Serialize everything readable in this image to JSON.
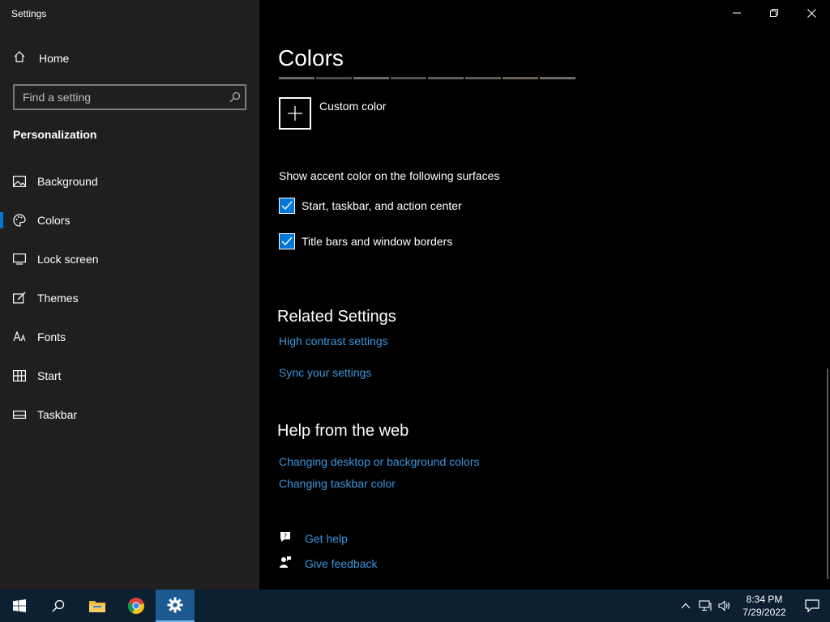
{
  "window": {
    "title": "Settings"
  },
  "sidebar": {
    "home_label": "Home",
    "search_placeholder": "Find a setting",
    "section_title": "Personalization",
    "items": [
      {
        "label": "Background",
        "icon": "picture-icon"
      },
      {
        "label": "Colors",
        "icon": "palette-icon",
        "active": true
      },
      {
        "label": "Lock screen",
        "icon": "lock-screen-icon"
      },
      {
        "label": "Themes",
        "icon": "themes-icon"
      },
      {
        "label": "Fonts",
        "icon": "fonts-icon"
      },
      {
        "label": "Start",
        "icon": "start-icon"
      },
      {
        "label": "Taskbar",
        "icon": "taskbar-icon"
      }
    ]
  },
  "main": {
    "title": "Colors",
    "swatches": [
      "#6b6b6b",
      "#4a4a4a",
      "#6b6b6b",
      "#4f4f4f",
      "#5a5f59",
      "#5b5b5b",
      "#6b6254",
      "#6b6b6b"
    ],
    "custom_color_label": "Custom color",
    "surfaces_label": "Show accent color on the following surfaces",
    "checkboxes": [
      {
        "label": "Start, taskbar, and action center",
        "checked": true
      },
      {
        "label": "Title bars and window borders",
        "checked": true
      }
    ],
    "related_title": "Related Settings",
    "related_links": [
      "High contrast settings",
      "Sync your settings"
    ],
    "help_title": "Help from the web",
    "help_links": [
      "Changing desktop or background colors",
      "Changing taskbar color"
    ],
    "get_help": "Get help",
    "give_feedback": "Give feedback"
  },
  "taskbar": {
    "time": "8:34 PM",
    "date": "7/29/2022"
  },
  "colors": {
    "accent": "#0078d7",
    "link": "#3a96dd",
    "sidebar_bg": "#1f1f1f",
    "taskbar_bg": "#0c2032"
  }
}
